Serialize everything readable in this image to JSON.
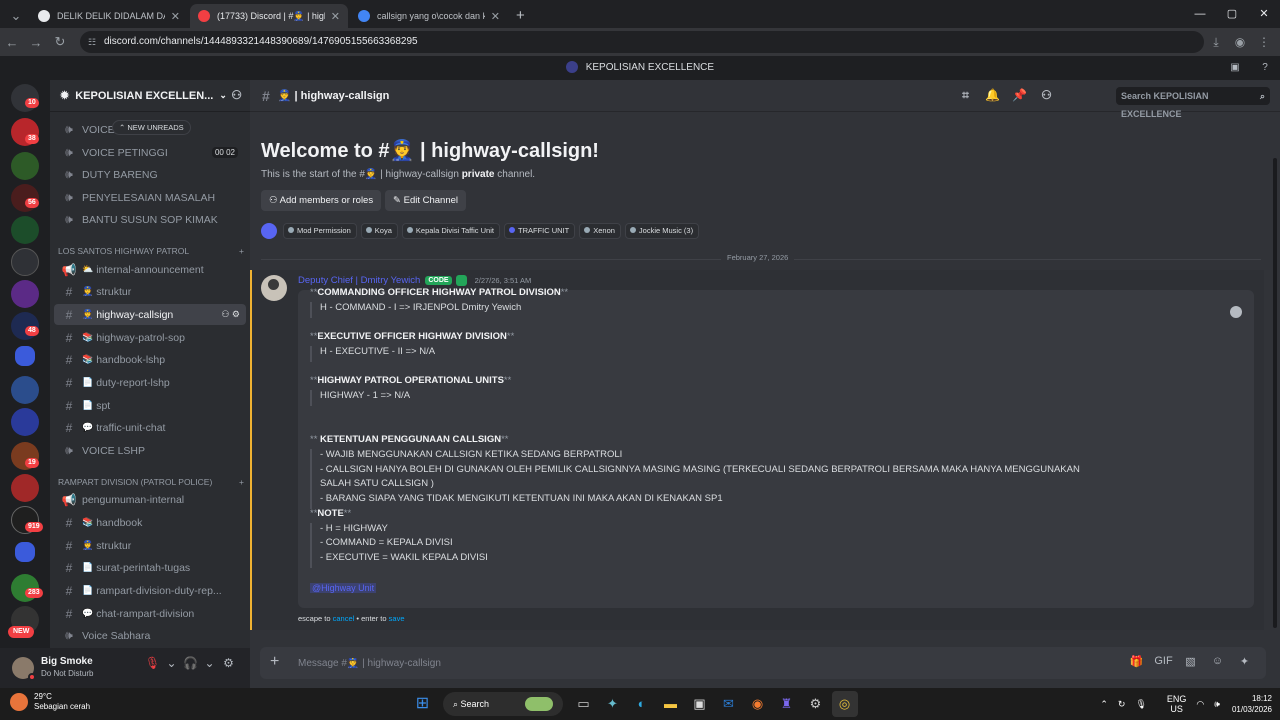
{
  "browser": {
    "tabs": [
      {
        "title": "DELIK DELIK DIDALAM DAN DI...",
        "color": "#e8eaed"
      },
      {
        "title": "(17733) Discord | #👮 | highway...",
        "color": "#f23f43"
      },
      {
        "title": "callsign yang o\\cocok dan kere...",
        "color": "#4285f4"
      }
    ],
    "new_tab": "+",
    "url": "discord.com/channels/1444893321448390689/1476905155663368295",
    "window_controls": {
      "minimize": "—",
      "maximize": "▢",
      "close": "✕"
    }
  },
  "title_bar": {
    "server_name": "KEPOLISIAN EXCELLENCE"
  },
  "guild_badges": [
    "10",
    "38",
    "56",
    "48",
    "19",
    "919",
    "283",
    "NEW"
  ],
  "sidebar": {
    "server_name": "KEPOLISIAN EXCELLEN...",
    "unread_pill": "NEW UNREADS",
    "channels_top": [
      {
        "label": "VOICE J...",
        "icon": "speaker-icon"
      },
      {
        "label": "VOICE PETINGGI",
        "icon": "speaker-icon",
        "count": "00",
        "count2": "02"
      },
      {
        "label": "DUTY BARENG",
        "icon": "speaker-icon"
      },
      {
        "label": "PENYELESAIAN MASALAH",
        "icon": "speaker-icon"
      },
      {
        "label": "BANTU SUSUN SOP KIMAK",
        "icon": "speaker-icon"
      }
    ],
    "category_1": "LOS SANTOS HIGHWAY PATROL",
    "channels_1": [
      {
        "label": "internal-announcement",
        "icon": "announcement-icon",
        "emoji": "⛅"
      },
      {
        "label": "struktur",
        "icon": "hash-icon",
        "emoji": "👮"
      },
      {
        "label": "highway-callsign",
        "icon": "hash-icon",
        "emoji": "👮",
        "selected": true
      },
      {
        "label": "highway-patrol-sop",
        "icon": "hash-icon",
        "emoji": "📚"
      },
      {
        "label": "handbook-lshp",
        "icon": "hash-icon",
        "emoji": "📚"
      },
      {
        "label": "duty-report-lshp",
        "icon": "hash-icon",
        "emoji": "📄"
      },
      {
        "label": "spt",
        "icon": "hash-icon",
        "emoji": "📄"
      },
      {
        "label": "traffic-unit-chat",
        "icon": "hash-icon",
        "emoji": "💬"
      },
      {
        "label": "VOICE LSHP",
        "icon": "speaker-icon"
      }
    ],
    "category_2": "RAMPART DIVISION (PATROL POLICE)",
    "channels_2": [
      {
        "label": "pengumuman-internal",
        "icon": "announcement-icon",
        "emoji": ""
      },
      {
        "label": "handbook",
        "icon": "hash-icon",
        "emoji": "📚"
      },
      {
        "label": "struktur",
        "icon": "hash-icon",
        "emoji": "👮"
      },
      {
        "label": "surat-perintah-tugas",
        "icon": "hash-icon",
        "emoji": "📄"
      },
      {
        "label": "rampart-division-duty-rep...",
        "icon": "hash-icon",
        "emoji": "📄"
      },
      {
        "label": "chat-rampart-division",
        "icon": "hash-icon",
        "emoji": "💬"
      },
      {
        "label": "Voice Sabhara",
        "icon": "speaker-icon"
      }
    ]
  },
  "user_panel": {
    "name": "Big Smoke",
    "status": "Do Not Disturb"
  },
  "channel_header": {
    "name": "👮 | highway-callsign",
    "search_placeholder": "Search KEPOLISIAN EXCELLENCE"
  },
  "welcome": {
    "title": "Welcome to #👮 | highway-callsign!",
    "sub_prefix": "This is the start of the #👮 | highway-callsign",
    "sub_bold": "private",
    "sub_suffix": "channel.",
    "add_members": "Add members or roles",
    "edit_channel": "Edit Channel",
    "roles": [
      "Mod Permission",
      "Koya",
      "Kepala Divisi Taffic Unit",
      "TRAFFIC UNIT",
      "Xenon",
      "Jockie Music (3)"
    ]
  },
  "date_divider": "February 27, 2026",
  "message": {
    "author": "Deputy Chief | Dmitry Yewich",
    "tag": "CODE",
    "time": "2/27/26, 3:51 AM",
    "lines": [
      {
        "type": "head",
        "text": "COMMANDING OFFICER HIGHWAY PATROL DIVISION"
      },
      {
        "type": "quote",
        "text": "H - COMMAND - I  => IRJENPOL Dmitry Yewich"
      },
      {
        "type": "head",
        "text": "EXECUTIVE OFFICER HIGHWAY DIVISION"
      },
      {
        "type": "quote",
        "text": "H - EXECUTIVE - II => N/A"
      },
      {
        "type": "head",
        "text": "HIGHWAY PATROL OPERATIONAL UNITS"
      },
      {
        "type": "quote",
        "text": "HIGHWAY - 1 => N/A"
      },
      {
        "type": "head",
        "text": " KETENTUAN PENGGUNAAN CALLSIGN"
      },
      {
        "type": "quote",
        "text": "- WAJIB MENGGUNAKAN CALLSIGN KETIKA SEDANG BERPATROLI"
      },
      {
        "type": "quote",
        "text": "- CALLSIGN HANYA BOLEH DI GUNAKAN OLEH PEMILIK CALLSIGNNYA MASING MASING (TERKECUALI SEDANG BERPATROLI BERSAMA MAKA HANYA MENGGUNAKAN"
      },
      {
        "type": "quote",
        "text": "SALAH SATU CALLSIGN )"
      },
      {
        "type": "quote",
        "text": "- BARANG SIAPA YANG TIDAK MENGIKUTI KETENTUAN INI MAKA AKAN DI KENAKAN SP1"
      },
      {
        "type": "head",
        "text": "NOTE"
      },
      {
        "type": "quote",
        "text": "- H = HIGHWAY"
      },
      {
        "type": "quote",
        "text": "- COMMAND = KEPALA DIVISI"
      },
      {
        "type": "quote",
        "text": "- EXECUTIVE = WAKIL KEPALA DIVISI"
      }
    ],
    "mention": "@Highway Unit",
    "hint_prefix": "escape to",
    "hint_cancel": "cancel",
    "hint_mid": "• enter to",
    "hint_save": "save"
  },
  "composer": {
    "placeholder": "Message #👮 | highway-callsign"
  },
  "taskbar": {
    "temp": "29°C",
    "weather": "Sebagian cerah",
    "search": "Search",
    "lang": "ENG",
    "region": "US",
    "time": "18:12",
    "date": "01/03/2026"
  },
  "colors": {
    "accent": "#5865f2",
    "bg": "#313338",
    "sidebar": "#2b2d31",
    "danger": "#f23f43"
  }
}
